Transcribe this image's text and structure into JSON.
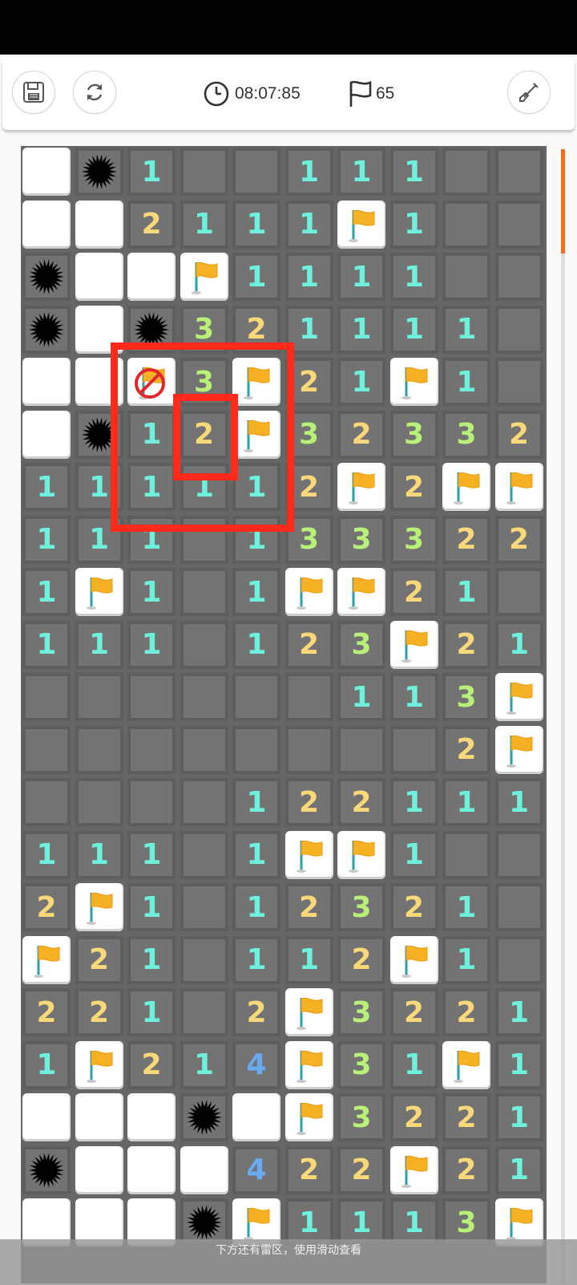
{
  "toolbar": {
    "timer": "08:07:85",
    "flag_count": "65"
  },
  "hint_text": "下方还有雷区，使用滑动查看",
  "colors": {
    "n1": "#6ff0dc",
    "n2": "#f8d878",
    "n3": "#b8f078",
    "n4": "#6aaaf0",
    "highlight": "#ff2a1a",
    "scroll_thumb": "#ff6a1a"
  },
  "legend": {
    "R": "revealed-empty",
    "U": "unrevealed",
    "M": "mine",
    "F": "flag",
    "X": "wrong-flag",
    "1-4": "number"
  },
  "board": {
    "cols": 10,
    "rows": [
      [
        "R",
        "M",
        "1",
        "U",
        "U",
        "1",
        "1",
        "1",
        "U",
        "U"
      ],
      [
        "R",
        "R",
        "2",
        "1",
        "1",
        "1",
        "F",
        "1",
        "U",
        "U"
      ],
      [
        "M",
        "R",
        "R",
        "F",
        "1",
        "1",
        "1",
        "1",
        "U",
        "U"
      ],
      [
        "M",
        "R",
        "M",
        "3",
        "2",
        "1",
        "1",
        "1",
        "1",
        "U"
      ],
      [
        "R",
        "R",
        "X",
        "3",
        "F",
        "2",
        "1",
        "F",
        "1",
        "U"
      ],
      [
        "R",
        "M",
        "1",
        "2",
        "F",
        "3",
        "2",
        "3",
        "3",
        "2"
      ],
      [
        "1",
        "1",
        "1",
        "1",
        "1",
        "2",
        "F",
        "2",
        "F",
        "F"
      ],
      [
        "1",
        "1",
        "1",
        "U",
        "1",
        "3",
        "3",
        "3",
        "2",
        "2"
      ],
      [
        "1",
        "F",
        "1",
        "U",
        "1",
        "F",
        "F",
        "2",
        "1",
        "U"
      ],
      [
        "1",
        "1",
        "1",
        "U",
        "1",
        "2",
        "3",
        "F",
        "2",
        "1"
      ],
      [
        "U",
        "U",
        "U",
        "U",
        "U",
        "U",
        "1",
        "1",
        "3",
        "F"
      ],
      [
        "U",
        "U",
        "U",
        "U",
        "U",
        "U",
        "U",
        "U",
        "2",
        "F"
      ],
      [
        "U",
        "U",
        "U",
        "U",
        "1",
        "2",
        "2",
        "1",
        "1",
        "1"
      ],
      [
        "1",
        "1",
        "1",
        "U",
        "1",
        "F",
        "F",
        "1",
        "U",
        "U"
      ],
      [
        "2",
        "F",
        "1",
        "U",
        "1",
        "2",
        "3",
        "2",
        "1",
        "U"
      ],
      [
        "F",
        "2",
        "1",
        "U",
        "1",
        "1",
        "2",
        "F",
        "1",
        "U"
      ],
      [
        "2",
        "2",
        "1",
        "U",
        "2",
        "F",
        "3",
        "2",
        "2",
        "1"
      ],
      [
        "1",
        "F",
        "2",
        "1",
        "4",
        "F",
        "3",
        "1",
        "F",
        "1"
      ],
      [
        "R",
        "R",
        "R",
        "M",
        "R",
        "F",
        "3",
        "2",
        "2",
        "1"
      ],
      [
        "M",
        "R",
        "R",
        "R",
        "4",
        "2",
        "2",
        "F",
        "2",
        "1"
      ],
      [
        "R",
        "R",
        "R",
        "M",
        "F",
        "1",
        "1",
        "1",
        "3",
        "F"
      ]
    ]
  }
}
